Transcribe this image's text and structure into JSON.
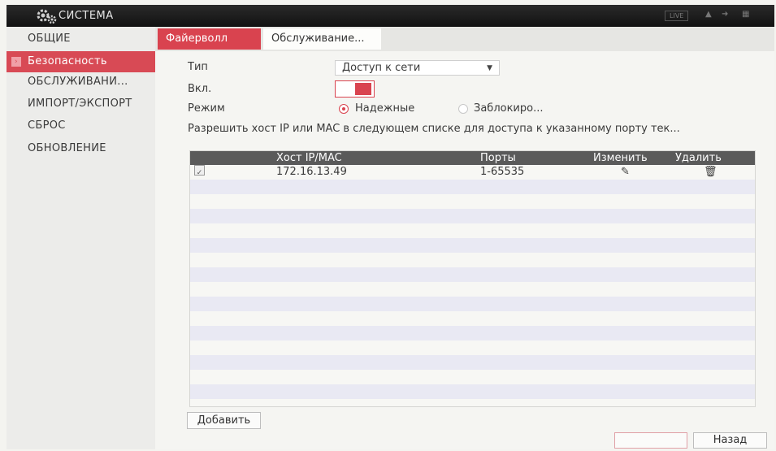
{
  "header": {
    "title": "СИСТЕМА",
    "live_label": "LIVE",
    "gear_icon": "gear-icon",
    "user_icon": "user-icon",
    "logout_icon": "logout-icon",
    "grid_icon": "grid-icon"
  },
  "sidebar": {
    "items": [
      {
        "label": "ОБЩИЕ"
      },
      {
        "label": "Безопасность"
      },
      {
        "label": "ОБСЛУЖИВАНИ..."
      },
      {
        "label": "ИМПОРТ/ЭКСПОРТ"
      },
      {
        "label": "СБРОС"
      },
      {
        "label": "ОБНОВЛЕНИЕ"
      }
    ]
  },
  "tabs": [
    {
      "label": "Файерволл"
    },
    {
      "label": "Обслуживание..."
    }
  ],
  "form": {
    "type_label": "Тип",
    "type_value": "Доступ к сети",
    "enable_label": "Вкл.",
    "mode_label": "Режим",
    "mode_trusted": "Надежные",
    "mode_blocked": "Заблокиро...",
    "hint": "Разрешить хост IP или MAC в следующем списке для доступа к указанному порту тек..."
  },
  "table": {
    "headers": [
      "Хост IP/MAC",
      "Порты",
      "Изменить",
      "Удалить"
    ],
    "rows": [
      {
        "host": "172.16.13.49",
        "ports": "1-65535",
        "checked": true
      }
    ]
  },
  "footer": {
    "add_label": "Добавить",
    "back_label": "Назад"
  },
  "colors": {
    "accent": "#d9434f",
    "header_bg": "#1a1a1a",
    "table_header": "#5a5a5a"
  }
}
